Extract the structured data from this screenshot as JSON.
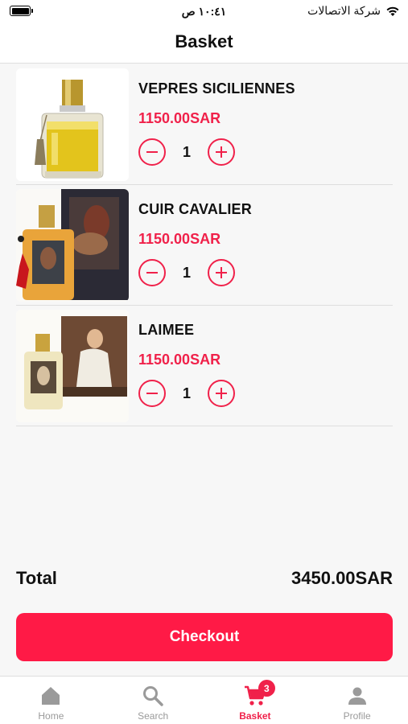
{
  "status_bar": {
    "time": "١٠:٤١ ص",
    "carrier": "شركة الاتصالات"
  },
  "header": {
    "title": "Basket"
  },
  "items": [
    {
      "name": "VEPRES SICILIENNES",
      "price": "1150.00SAR",
      "quantity": "1"
    },
    {
      "name": "CUIR CAVALIER",
      "price": "1150.00SAR",
      "quantity": "1"
    },
    {
      "name": "LAIMEE",
      "price": "1150.00SAR",
      "quantity": "1"
    }
  ],
  "total": {
    "label": "Total",
    "value": "3450.00SAR"
  },
  "checkout": {
    "label": "Checkout"
  },
  "tabs": [
    {
      "label": "Home",
      "icon": "home-icon"
    },
    {
      "label": "Search",
      "icon": "search-icon"
    },
    {
      "label": "Basket",
      "icon": "cart-icon",
      "badge": "3",
      "active": true
    },
    {
      "label": "Profile",
      "icon": "user-icon"
    }
  ],
  "colors": {
    "accent": "#f0214a",
    "checkout_bg": "#ff1a46",
    "inactive": "#9a9a9a"
  }
}
